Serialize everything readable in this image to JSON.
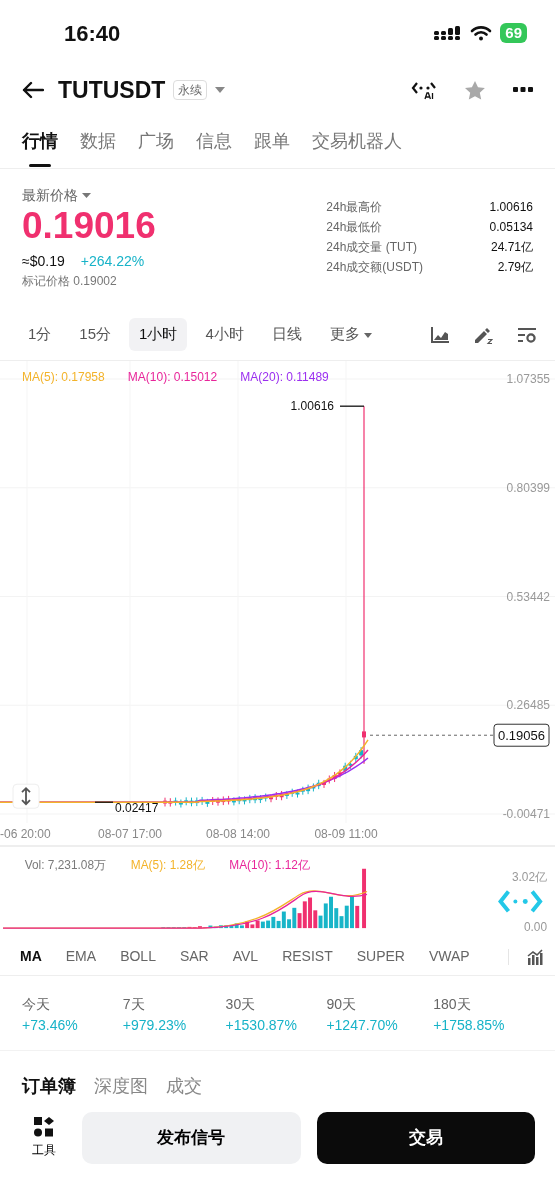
{
  "status_bar": {
    "time": "16:40",
    "battery": "69"
  },
  "header": {
    "symbol": "TUTUSDT",
    "badge": "永续"
  },
  "tabs": [
    {
      "label": "行情",
      "selected": true
    },
    {
      "label": "数据",
      "selected": false
    },
    {
      "label": "广场",
      "selected": false
    },
    {
      "label": "信息",
      "selected": false
    },
    {
      "label": "跟单",
      "selected": false
    },
    {
      "label": "交易机器人",
      "selected": false
    }
  ],
  "price": {
    "label": "最新价格",
    "last": "0.19016",
    "usd": "≈$0.19",
    "change": "+264.22%",
    "mark": "标记价格 0.19002"
  },
  "stats": [
    {
      "label": "24h最高价",
      "value": "1.00616"
    },
    {
      "label": "24h最低价",
      "value": "0.05134"
    },
    {
      "label": "24h成交量 (TUT)",
      "value": "24.71亿"
    },
    {
      "label": "24h成交额(USDT)",
      "value": "2.79亿"
    }
  ],
  "intervals": [
    {
      "label": "1分",
      "selected": false,
      "dropdown": false
    },
    {
      "label": "15分",
      "selected": false,
      "dropdown": false
    },
    {
      "label": "1小时",
      "selected": true,
      "dropdown": false
    },
    {
      "label": "4小时",
      "selected": false,
      "dropdown": false
    },
    {
      "label": "日线",
      "selected": false,
      "dropdown": false
    },
    {
      "label": "更多",
      "selected": false,
      "dropdown": true
    }
  ],
  "chart": {
    "ma_legend": [
      {
        "label": "MA(5): 0.17958",
        "color": "#f3b32a"
      },
      {
        "label": "MA(10): 0.15012",
        "color": "#e8259a"
      },
      {
        "label": "MA(20): 0.11489",
        "color": "#9b2ff0"
      }
    ],
    "price_labels": [
      "1.07355",
      "0.80399",
      "0.53442",
      "0.26485",
      "-0.00471"
    ],
    "high_label": "1.00616",
    "low_label": "0.02417",
    "last_price": "0.19056",
    "time_labels": [
      "-06 20:00",
      "08-07 17:00",
      "08-08 14:00",
      "08-09 11:00"
    ]
  },
  "volume": {
    "legend": [
      {
        "label": "Vol: 7,231.08万",
        "color": "#7a7a7a"
      },
      {
        "label": "MA(5): 1.28亿",
        "color": "#f3b32a"
      },
      {
        "label": "MA(10): 1.12亿",
        "color": "#e8259a"
      }
    ],
    "axis_labels": [
      "3.02亿",
      "0.00"
    ]
  },
  "indicators": [
    {
      "label": "MA",
      "selected": true
    },
    {
      "label": "EMA",
      "selected": false
    },
    {
      "label": "BOLL",
      "selected": false
    },
    {
      "label": "SAR",
      "selected": false
    },
    {
      "label": "AVL",
      "selected": false
    },
    {
      "label": "RESIST",
      "selected": false
    },
    {
      "label": "SUPER",
      "selected": false
    },
    {
      "label": "VWAP",
      "selected": false
    }
  ],
  "performance": [
    {
      "period": "今天",
      "change": "+73.46%"
    },
    {
      "period": "7天",
      "change": "+979.23%"
    },
    {
      "period": "30天",
      "change": "+1530.87%"
    },
    {
      "period": "90天",
      "change": "+1247.70%"
    },
    {
      "period": "180天",
      "change": "+1758.85%"
    }
  ],
  "book_tabs": [
    {
      "label": "订单簿",
      "selected": true
    },
    {
      "label": "深度图",
      "selected": false
    },
    {
      "label": "成交",
      "selected": false
    }
  ],
  "toolbar": {
    "tools_label": "工具",
    "signal_button": "发布信号",
    "trade_button": "交易"
  }
}
